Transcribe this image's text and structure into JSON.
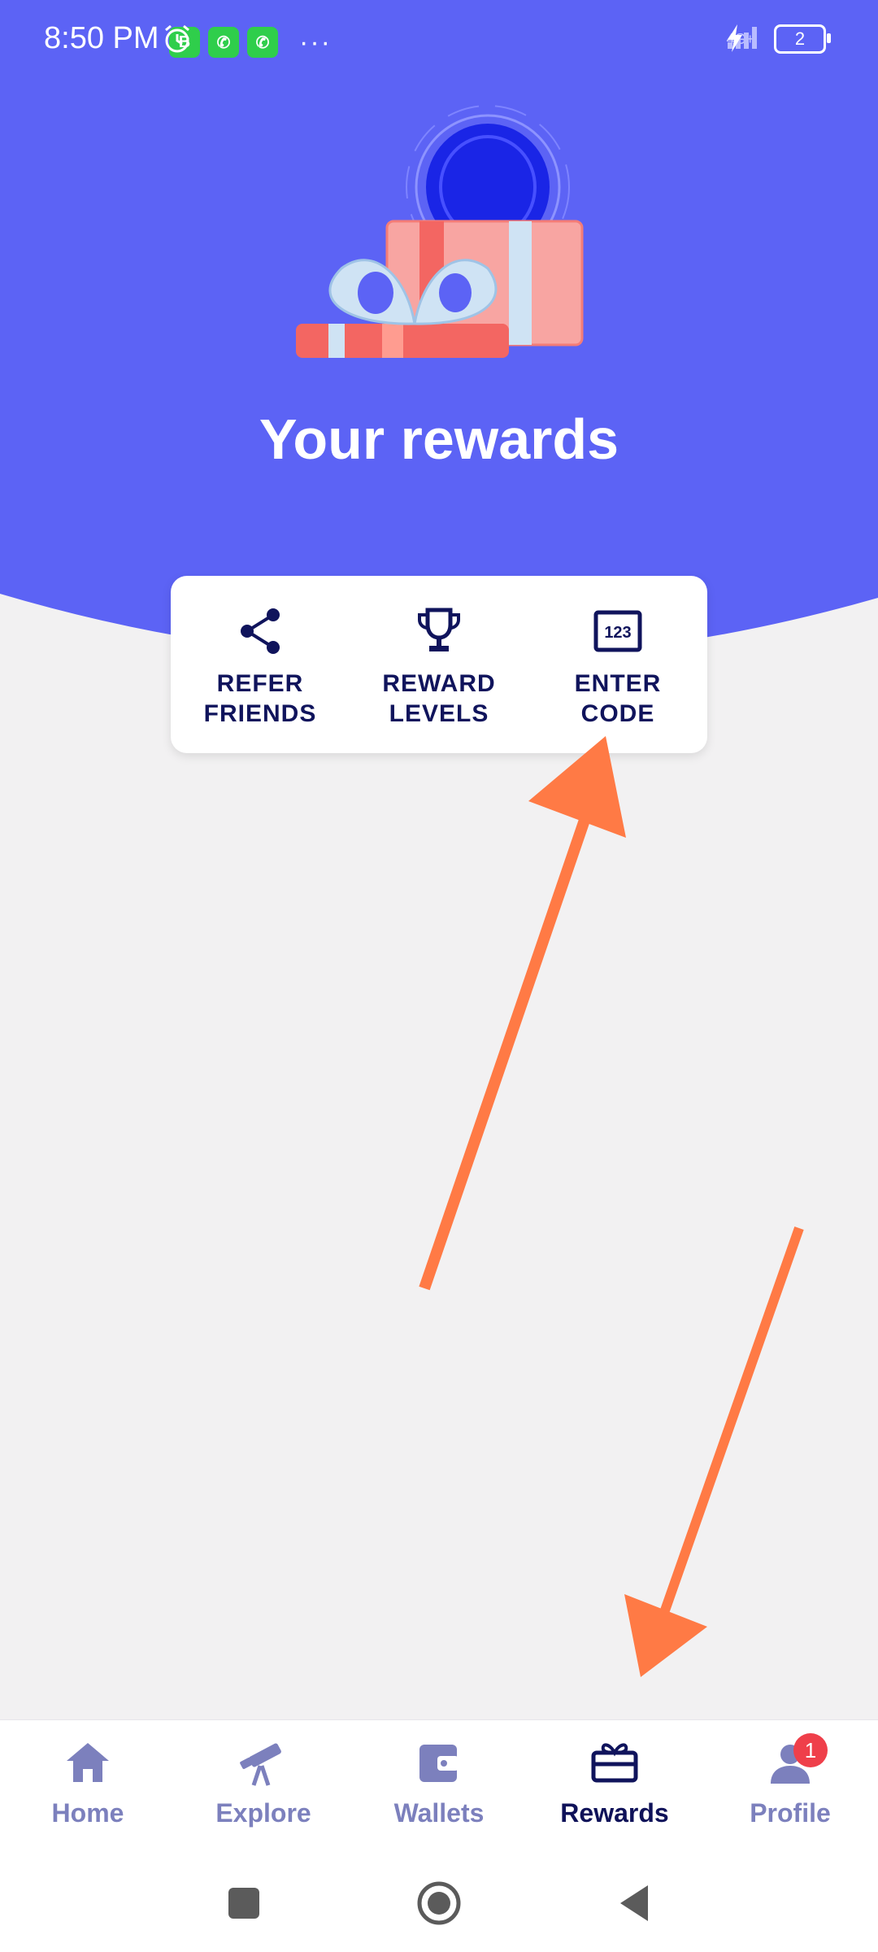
{
  "status_bar": {
    "time": "8:50 PM",
    "network": "4G+",
    "battery": "2",
    "notification_icons": [
      "alarm-icon",
      "whatsapp-business-icon",
      "whatsapp-icon",
      "whatsapp-icon"
    ],
    "overflow": "···"
  },
  "hero": {
    "title": "Your rewards",
    "background_color": "#5c63f5"
  },
  "actions": [
    {
      "label": "REFER\nFRIENDS",
      "icon": "share-icon"
    },
    {
      "label": "REWARD\nLEVELS",
      "icon": "trophy-icon"
    },
    {
      "label": "ENTER\nCODE",
      "icon": "keypad-123-icon",
      "icon_text": "123"
    }
  ],
  "bottom_nav": {
    "items": [
      {
        "label": "Home",
        "icon": "home-icon"
      },
      {
        "label": "Explore",
        "icon": "telescope-icon"
      },
      {
        "label": "Wallets",
        "icon": "wallet-icon"
      },
      {
        "label": "Rewards",
        "icon": "gift-icon",
        "active": true
      },
      {
        "label": "Profile",
        "icon": "profile-icon",
        "badge": "1"
      }
    ]
  },
  "annotation_color": "#ff7a45",
  "accent_color": "#10145c"
}
